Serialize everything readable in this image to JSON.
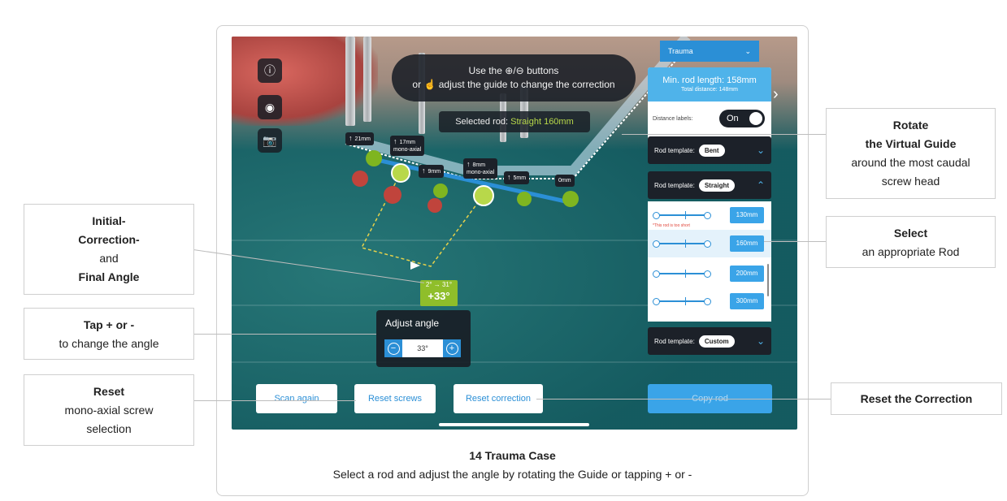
{
  "hint": {
    "line1a": "Use the",
    "line1b": "buttons",
    "line2a": "or",
    "line2b": "adjust the guide to change the correction"
  },
  "selected_rod": {
    "label": "Selected rod:",
    "value": "Straight 160mm"
  },
  "screw_labels": [
    {
      "text": "21mm",
      "sub": ""
    },
    {
      "text": "17mm",
      "sub": "mono-axial"
    },
    {
      "text": "9mm",
      "sub": ""
    },
    {
      "text": "8mm",
      "sub": "mono-axial"
    },
    {
      "text": "5mm",
      "sub": ""
    },
    {
      "text": "0mm",
      "sub": ""
    }
  ],
  "angle_tag": {
    "small": "2° → 31°",
    "big": "+33°"
  },
  "adjust_angle": {
    "title": "Adjust angle",
    "value": "33°"
  },
  "buttons": {
    "scan_again": "Scan again",
    "reset_screws": "Reset screws",
    "reset_correction": "Reset correction",
    "copy_rod": "Copy rod"
  },
  "right_panel": {
    "case_type": "Trauma",
    "min_rod": "Min. rod length: 158mm",
    "total_distance": "Total distance: 148mm",
    "distance_labels": "Distance labels:",
    "toggle": "On",
    "templates": [
      {
        "label": "Rod template:",
        "value": "Bent"
      },
      {
        "label": "Rod template:",
        "value": "Straight"
      },
      {
        "label": "Rod template:",
        "value": "Custom"
      }
    ],
    "rods": [
      {
        "mm": "130mm",
        "warn": "*This rod is too short"
      },
      {
        "mm": "160mm",
        "warn": ""
      },
      {
        "mm": "200mm",
        "warn": ""
      },
      {
        "mm": "300mm",
        "warn": ""
      }
    ]
  },
  "callouts": {
    "initial": {
      "l1": "Initial-",
      "l2": "Correction-",
      "l3": "and",
      "l4": "Final Angle"
    },
    "tap": {
      "l1": "Tap + or -",
      "l2": "to change the angle"
    },
    "reset": {
      "l1": "Reset",
      "l2": "mono-axial screw",
      "l3": "selection"
    },
    "rotate": {
      "l1": "Rotate",
      "l2": "the Virtual Guide",
      "l3": "around the most caudal",
      "l4": "screw head"
    },
    "select": {
      "l1": "Select",
      "l2": "an appropriate Rod"
    },
    "reset_corr": {
      "l1": "Reset the Correction"
    }
  },
  "caption": {
    "title": "14 Trauma Case",
    "subtitle": "Select a rod and adjust the angle by rotating the Guide or tapping + or -"
  },
  "colors": {
    "accent": "#2b8fd6",
    "green": "#8fbe2a",
    "dark": "#1c2129"
  },
  "icons": [
    "info-icon",
    "record-icon",
    "camera-icon",
    "plus-circle-icon",
    "minus-circle-icon",
    "touch-gesture-icon",
    "chevron-down-icon",
    "chevron-up-icon",
    "chevron-right-icon"
  ]
}
